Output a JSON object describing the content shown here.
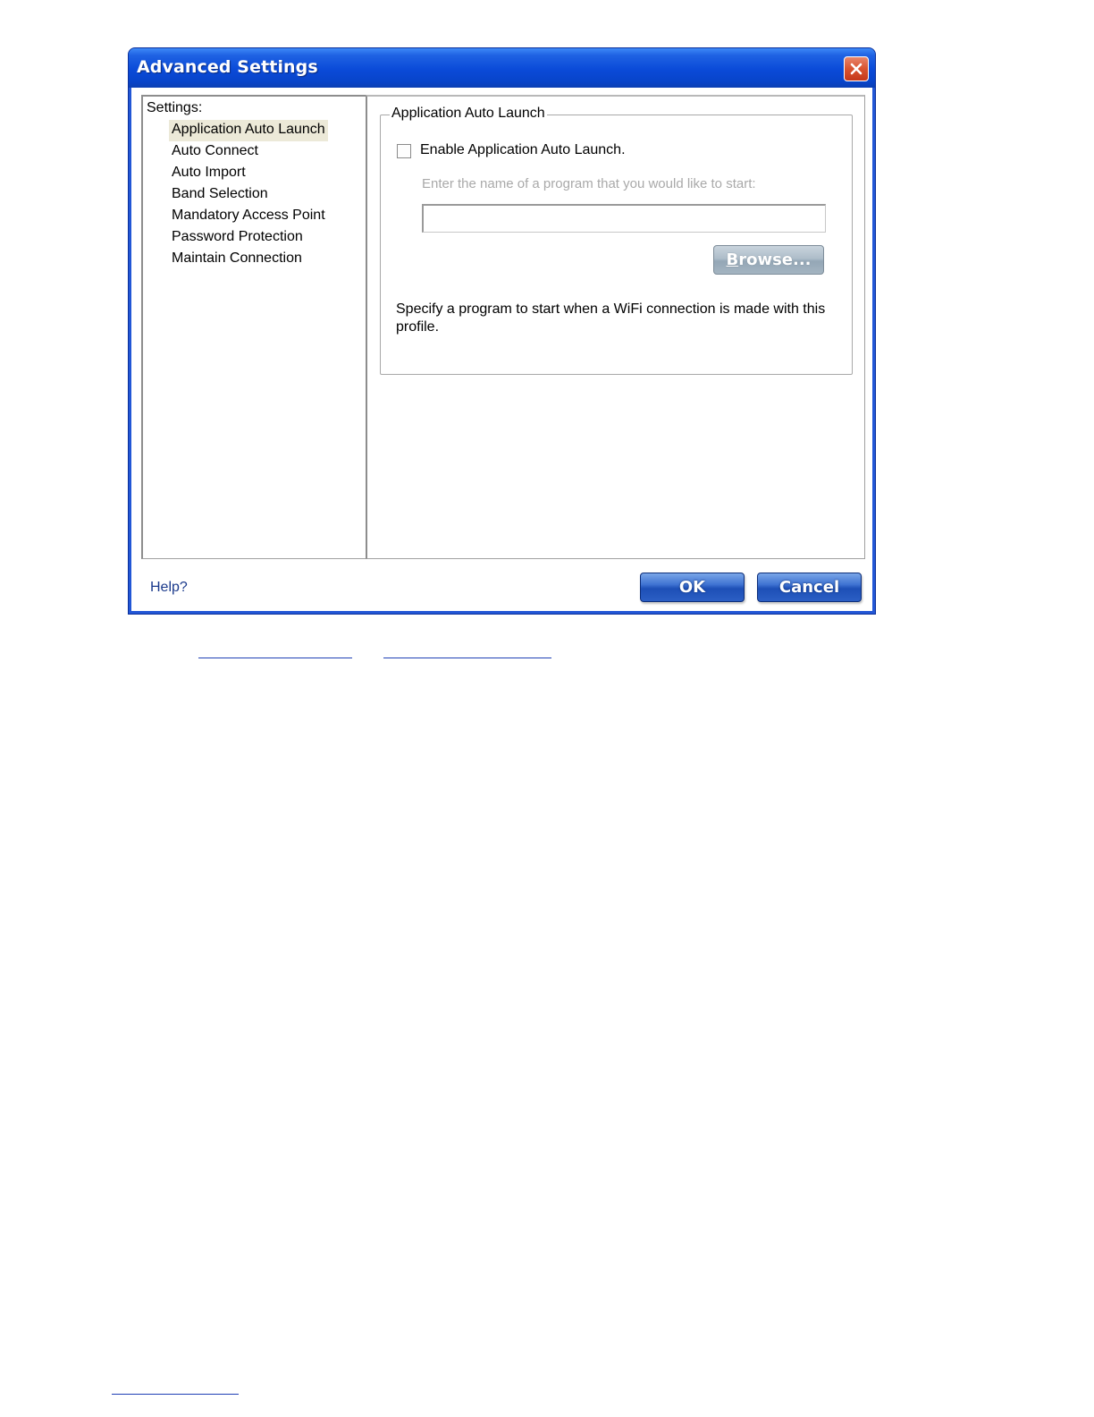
{
  "window": {
    "title": "Advanced Settings",
    "close_icon": "close-icon"
  },
  "sidebar": {
    "heading": "Settings:",
    "items": [
      {
        "label": "Application Auto Launch",
        "selected": true
      },
      {
        "label": "Auto Connect",
        "selected": false
      },
      {
        "label": "Auto Import",
        "selected": false
      },
      {
        "label": "Band Selection",
        "selected": false
      },
      {
        "label": "Mandatory Access Point",
        "selected": false
      },
      {
        "label": "Password Protection",
        "selected": false
      },
      {
        "label": "Maintain Connection",
        "selected": false
      }
    ]
  },
  "main": {
    "group_title": "Application Auto Launch",
    "enable_checkbox_label": "Enable Application Auto Launch.",
    "enable_checked": false,
    "program_prompt": "Enter the name of a program that you would like to start:",
    "program_value": "",
    "browse_label_accel": "B",
    "browse_label_rest": "rowse...",
    "description": "Specify a program to start when a WiFi connection is made with this profile."
  },
  "footer": {
    "help_label": "Help?",
    "ok_label": "OK",
    "cancel_label": "Cancel"
  },
  "colors": {
    "title_bar": "#0a4ad8",
    "selection_bg": "#ece9d8",
    "help_link": "#1b3a8c",
    "disabled_text": "#a9a9a9"
  }
}
